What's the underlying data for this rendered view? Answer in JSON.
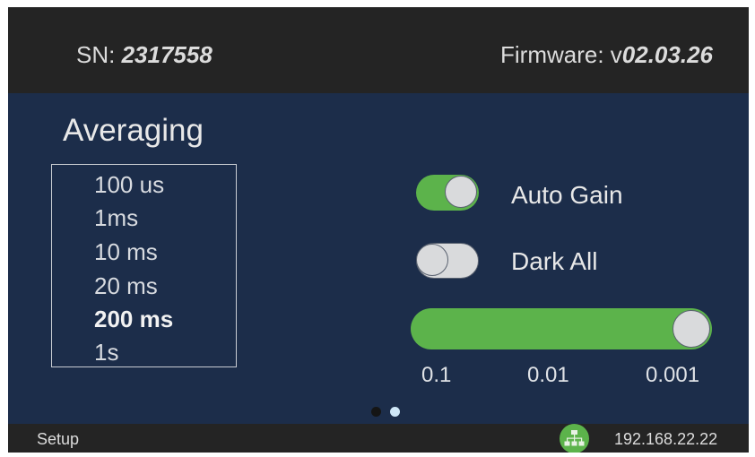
{
  "header": {
    "sn_label": "SN: ",
    "sn_value": "2317558",
    "firmware_label": "Firmware: v",
    "firmware_value": "02.03.26"
  },
  "averaging": {
    "title": "Averaging",
    "options": [
      "100 us",
      "1ms",
      "10 ms",
      "20 ms",
      "200 ms",
      "1s"
    ],
    "selected": "200 ms"
  },
  "toggles": {
    "auto_gain": {
      "label": "Auto Gain",
      "on": true
    },
    "dark_all": {
      "label": "Dark All",
      "on": false
    }
  },
  "slider": {
    "tick_labels": [
      "0.1",
      "0.01",
      "0.001"
    ],
    "position_fraction": 1.0,
    "fill_color": "#5cb34b"
  },
  "pagination": {
    "count": 2,
    "current": 2
  },
  "footer": {
    "label": "Setup",
    "network_icon": "network-connected-icon",
    "ip": "192.168.22.22"
  },
  "colors": {
    "background": "#1c2d4a",
    "bar": "#242424",
    "accent_green": "#5cb34b",
    "active_dot": "#cfe7f7"
  }
}
